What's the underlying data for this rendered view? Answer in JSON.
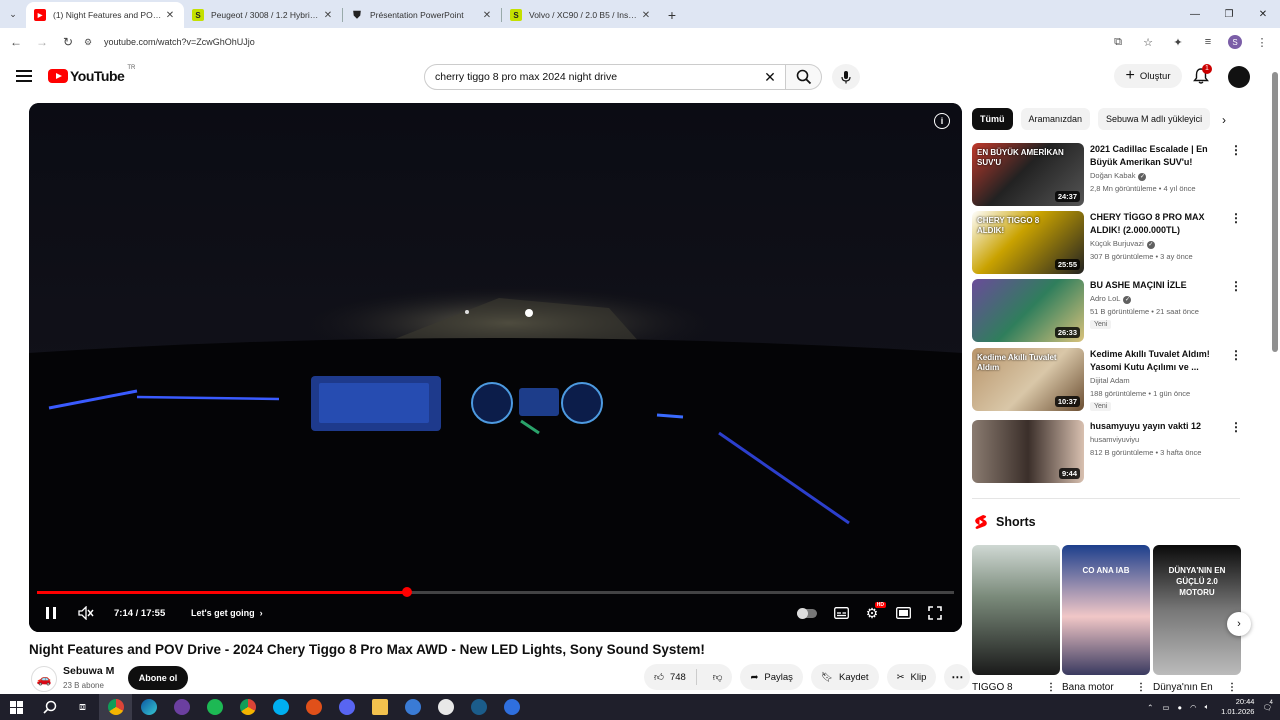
{
  "browser": {
    "tabs": [
      {
        "title": "(1) Night Features and POV Drive",
        "active": true,
        "favicon": "youtube-icon",
        "color": "#ff0000"
      },
      {
        "title": "Peugeot / 3008 / 1.2 Hybrid / A",
        "active": false,
        "favicon": "s",
        "color": "#c4e000"
      },
      {
        "title": "Présentation PowerPoint",
        "active": false,
        "favicon": "shield",
        "color": "#222222"
      },
      {
        "title": "Volvo / XC90 / 2.0 B5 / Inscripti",
        "active": false,
        "favicon": "s",
        "color": "#c4e000"
      }
    ],
    "url": "youtube.com/watch?v=ZcwGhOhUJjo"
  },
  "youtube": {
    "logo_text": "YouTube",
    "country_code": "TR",
    "search_query": "cherry tiggo 8 pro max 2024 night drive",
    "create_label": "Oluştur",
    "notification_count": "1"
  },
  "player": {
    "current_time": "7:14 / 17:55",
    "chapter": "Let's get going",
    "progress": 0.404,
    "buffered": 0.42
  },
  "video": {
    "title": "Night Features and POV Drive - 2024 Chery Tiggo 8 Pro Max AWD - New LED Lights, Sony Sound System!",
    "channel": "Sebuwa M",
    "subscribers": "23 B abone",
    "subscribe_label": "Abone ol",
    "likes": "748",
    "share_label": "Paylaş",
    "save_label": "Kaydet",
    "clip_label": "Klip"
  },
  "chips": [
    "Tümü",
    "Aramanızdan",
    "Sebuwa M adlı yükleyici"
  ],
  "recommendations": [
    {
      "title": "2021 Cadillac Escalade | En Büyük Amerikan SUV'u!",
      "channel": "Doğan Kabak",
      "verified": true,
      "meta": "2,8 Mn görüntüleme • 4 yıl önce",
      "duration": "24:37",
      "badge": "",
      "thumb_text": "EN BÜYÜK AMERİKAN SUV'U"
    },
    {
      "title": "CHERY TİGGO 8 PRO MAX ALDIK! (2.000.000TL)",
      "channel": "Küçük Burjuvazi",
      "verified": true,
      "meta": "307 B görüntüleme • 3 ay önce",
      "duration": "25:55",
      "badge": "",
      "thumb_text": "CHERY TIGGO 8 ALDIK!"
    },
    {
      "title": "BU ASHE MAÇINI İZLE",
      "channel": "Adro LoL",
      "verified": true,
      "meta": "51 B görüntüleme • 21 saat önce",
      "duration": "26:33",
      "badge": "Yeni",
      "thumb_text": ""
    },
    {
      "title": "Kedime Akıllı Tuvalet Aldım! Yasomi Kutu Açılımı ve ...",
      "channel": "Dijital Adam",
      "verified": false,
      "meta": "188 görüntüleme • 1 gün önce",
      "duration": "10:37",
      "badge": "Yeni",
      "thumb_text": "Kedime Akıllı Tuvalet Aldım"
    },
    {
      "title": "husamyuyu yayın vakti 12",
      "channel": "husamviyuviyu",
      "verified": false,
      "meta": "812 B görüntüleme • 3 hafta önce",
      "duration": "9:44",
      "badge": "",
      "thumb_text": ""
    }
  ],
  "shorts": {
    "heading": "Shorts",
    "items": [
      {
        "caption": "TİGGO 8",
        "thumb_text": ""
      },
      {
        "caption": "Bana motor",
        "thumb_text": "CO  ANA  IAB"
      },
      {
        "caption": "Dünya'nın En",
        "thumb_text": "DÜNYA'NIN EN GÜÇLÜ 2.0 MOTORU"
      }
    ]
  },
  "taskbar": {
    "time": "20:44",
    "date": "1.01.2026",
    "notifications": "4"
  },
  "colors": {
    "accent": "#ff0000",
    "tab_bar": "#dfe6f3"
  }
}
